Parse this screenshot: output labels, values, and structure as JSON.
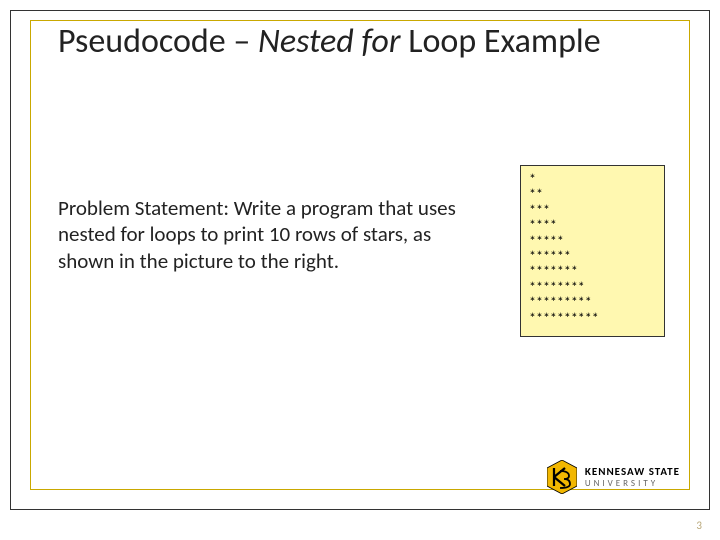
{
  "title": {
    "part1": "Pseudocode – ",
    "italic1": "Nested for ",
    "part2": "Loop Example"
  },
  "body": "Problem Statement: Write a program that uses nested for loops to print 10 rows of stars, as shown in the picture to the right.",
  "stars": [
    "*",
    "**",
    "***",
    "****",
    "*****",
    "******",
    "*******",
    "********",
    "*********",
    "**********"
  ],
  "logo": {
    "line1": "KENNESAW STATE",
    "line2": "UNIVERSITY"
  },
  "page_number": "3",
  "colors": {
    "gold": "#f2b700",
    "box_bg": "#fff8b0"
  }
}
